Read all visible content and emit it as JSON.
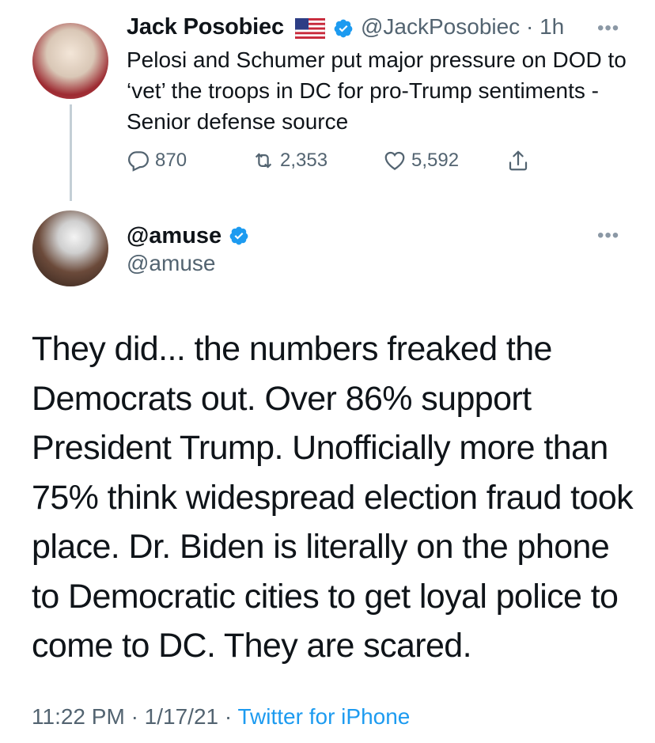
{
  "thread_tweet": {
    "author_name": "Jack Posobiec",
    "handle_time": "@JackPosobiec · 1h",
    "more": "•••",
    "text": "Pelosi and Schumer put major pressure on DOD to ‘vet’ the troops in DC for pro-Trump sentiments - Senior defense source",
    "replies": "870",
    "retweets": "2,353",
    "likes": "5,592"
  },
  "main_tweet": {
    "author_name": "@amuse",
    "handle": "@amuse",
    "more": "•••",
    "text": "They did... the numbers freaked the Democrats out. Over 86% support President Trump. Unofficially more than 75% think widespread election fraud took place. Dr. Biden is literally on the phone to Democratic cities to get loyal police to come to DC. They are scared.",
    "time": "11:22 PM",
    "date": "1/17/21",
    "source": "Twitter for iPhone"
  },
  "colors": {
    "verified": "#1d9bf0",
    "secondary_text": "#536471",
    "link": "#1d9bf0"
  }
}
